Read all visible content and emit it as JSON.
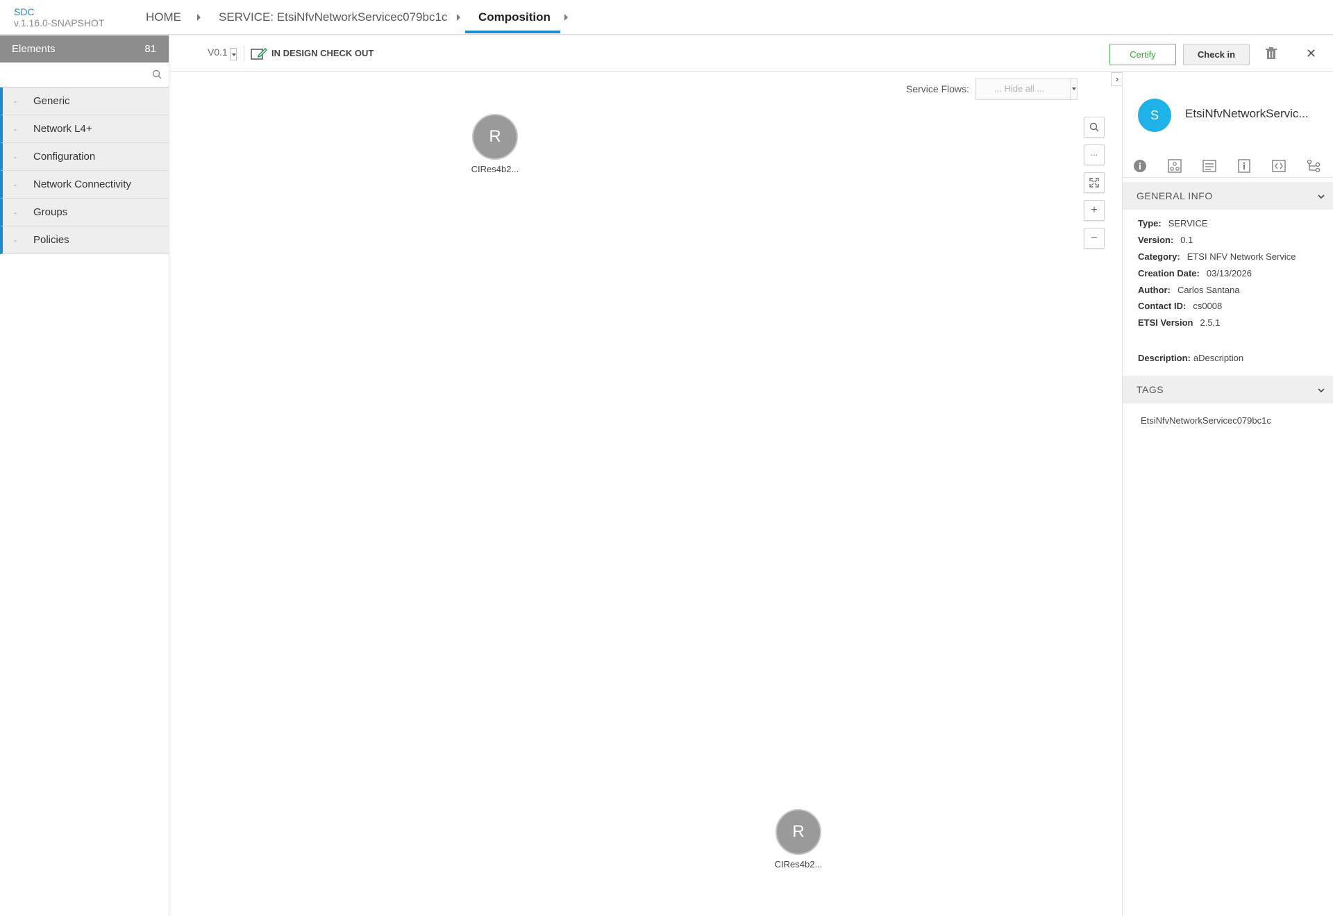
{
  "brand": {
    "name": "SDC",
    "version": "v.1.16.0-SNAPSHOT"
  },
  "breadcrumbs": {
    "home": "HOME",
    "service": "SERVICE: EtsiNfvNetworkServicec079bc1c",
    "composition": "Composition"
  },
  "sidebar": {
    "title": "Elements",
    "count": "81",
    "search_placeholder": "",
    "categories": [
      {
        "label": "Generic"
      },
      {
        "label": "Network L4+"
      },
      {
        "label": "Configuration"
      },
      {
        "label": "Network Connectivity"
      },
      {
        "label": "Groups"
      },
      {
        "label": "Policies"
      }
    ]
  },
  "toolbar": {
    "version": "V0.1",
    "status": "IN DESIGN CHECK OUT",
    "certify_label": "Certify",
    "checkin_label": "Check in",
    "close_glyph": "✕"
  },
  "canvas": {
    "flows_label": "Service Flows:",
    "flows_value": "... Hide all ...",
    "zoom_buttons": [
      "search",
      "more",
      "fit",
      "zoom-in",
      "zoom-out"
    ],
    "nodes": [
      {
        "initial": "R",
        "label": "CIRes4b2..."
      },
      {
        "initial": "R",
        "label": "CIRes4b2..."
      }
    ]
  },
  "right_panel": {
    "avatar_initial": "S",
    "title": "EtsiNfvNetworkServic...",
    "tabs": [
      "info-icon",
      "composition-icon",
      "artifacts-icon",
      "details-icon",
      "api-icon",
      "relations-icon"
    ],
    "general_info_title": "GENERAL INFO",
    "info": {
      "type_k": "Type:",
      "type_v": "SERVICE",
      "version_k": "Version:",
      "version_v": "0.1",
      "category_k": "Category:",
      "category_v": "ETSI NFV Network Service",
      "creation_k": "Creation Date:",
      "creation_v": "03/13/2026",
      "author_k": "Author:",
      "author_v": "Carlos Santana",
      "contact_k": "Contact ID:",
      "contact_v": "cs0008",
      "etsi_k": "ETSI Version",
      "etsi_v": "2.5.1",
      "desc_k": "Description:",
      "desc_v": "aDescription"
    },
    "tags_title": "TAGS",
    "tags": [
      "EtsiNfvNetworkServicec079bc1c"
    ]
  },
  "colors": {
    "accent": "#1e8ccf",
    "certify": "#5cb85c",
    "avatar": "#1fb2e8",
    "node": "#9a9a9a"
  }
}
